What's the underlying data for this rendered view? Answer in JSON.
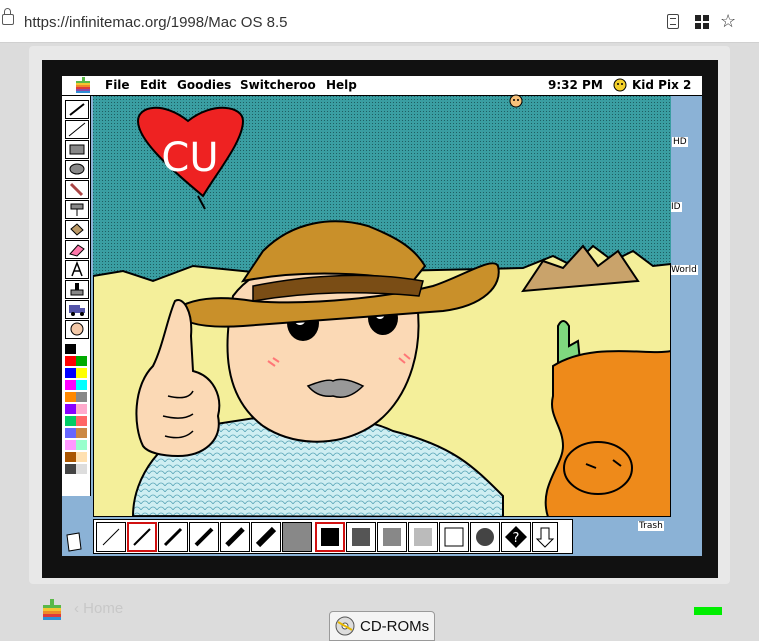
{
  "browser": {
    "url": "https://infinitemac.org/1998/Mac OS 8.5"
  },
  "mac": {
    "menu": [
      "File",
      "Edit",
      "Goodies",
      "Switcheroo",
      "Help"
    ],
    "clock": "9:32 PM",
    "app_name": "Kid Pix 2",
    "desktop_icons": [
      "HD",
      "ID",
      "World",
      "Trash"
    ]
  },
  "drawing": {
    "heart_text": "CU"
  },
  "palette_colors": [
    "#000000",
    "#ffffff",
    "#ff0000",
    "#00aa00",
    "#0000ff",
    "#ffff00",
    "#ff00ff",
    "#00ffff",
    "#ff8800",
    "#888888",
    "#8800ff",
    "#ffaacc"
  ],
  "footer": {
    "home_label": "‹ Home",
    "cd_label": "CD-ROMs"
  }
}
